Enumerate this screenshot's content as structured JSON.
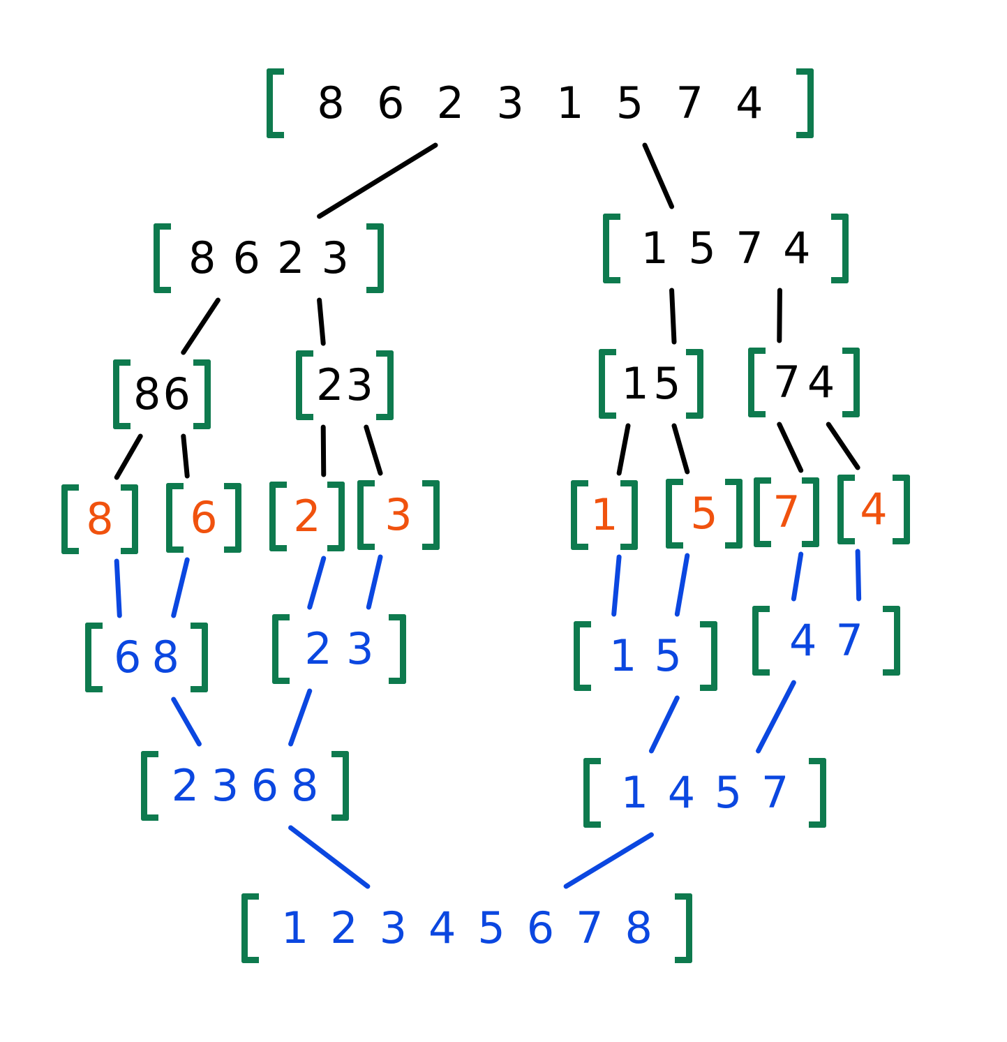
{
  "colors": {
    "bracket": "#0e7a4e",
    "split": "#000000",
    "leaf": "#f0520e",
    "merge": "#0b47e0"
  },
  "nodes": [
    {
      "id": "root",
      "stage": "split",
      "digits": [
        "8",
        "6",
        "2",
        "3",
        "1",
        "5",
        "7",
        "4"
      ]
    },
    {
      "id": "split-l",
      "stage": "split",
      "digits": [
        "8",
        "6",
        "2",
        "3"
      ]
    },
    {
      "id": "split-r",
      "stage": "split",
      "digits": [
        "1",
        "5",
        "7",
        "4"
      ]
    },
    {
      "id": "split-ll",
      "stage": "split",
      "digits": [
        "8",
        "6"
      ]
    },
    {
      "id": "split-lr",
      "stage": "split",
      "digits": [
        "2",
        "3"
      ]
    },
    {
      "id": "split-rl",
      "stage": "split",
      "digits": [
        "1",
        "5"
      ]
    },
    {
      "id": "split-rr",
      "stage": "split",
      "digits": [
        "7",
        "4"
      ]
    },
    {
      "id": "leaf-8",
      "stage": "leaf",
      "digits": [
        "8"
      ]
    },
    {
      "id": "leaf-6",
      "stage": "leaf",
      "digits": [
        "6"
      ]
    },
    {
      "id": "leaf-2",
      "stage": "leaf",
      "digits": [
        "2"
      ]
    },
    {
      "id": "leaf-3",
      "stage": "leaf",
      "digits": [
        "3"
      ]
    },
    {
      "id": "leaf-1",
      "stage": "leaf",
      "digits": [
        "1"
      ]
    },
    {
      "id": "leaf-5",
      "stage": "leaf",
      "digits": [
        "5"
      ]
    },
    {
      "id": "leaf-7",
      "stage": "leaf",
      "digits": [
        "7"
      ]
    },
    {
      "id": "leaf-4",
      "stage": "leaf",
      "digits": [
        "4"
      ]
    },
    {
      "id": "merge-68",
      "stage": "merge",
      "digits": [
        "6",
        "8"
      ]
    },
    {
      "id": "merge-23",
      "stage": "merge",
      "digits": [
        "2",
        "3"
      ]
    },
    {
      "id": "merge-15",
      "stage": "merge",
      "digits": [
        "1",
        "5"
      ]
    },
    {
      "id": "merge-47",
      "stage": "merge",
      "digits": [
        "4",
        "7"
      ]
    },
    {
      "id": "merge-2368",
      "stage": "merge",
      "digits": [
        "2",
        "3",
        "6",
        "8"
      ]
    },
    {
      "id": "merge-1457",
      "stage": "merge",
      "digits": [
        "1",
        "4",
        "5",
        "7"
      ]
    },
    {
      "id": "result",
      "stage": "merge",
      "digits": [
        "1",
        "2",
        "3",
        "4",
        "5",
        "6",
        "7",
        "8"
      ]
    }
  ],
  "edges": [
    {
      "from": "root",
      "to": "split-l",
      "stage": "split"
    },
    {
      "from": "root",
      "to": "split-r",
      "stage": "split"
    },
    {
      "from": "split-l",
      "to": "split-ll",
      "stage": "split"
    },
    {
      "from": "split-l",
      "to": "split-lr",
      "stage": "split"
    },
    {
      "from": "split-r",
      "to": "split-rl",
      "stage": "split"
    },
    {
      "from": "split-r",
      "to": "split-rr",
      "stage": "split"
    },
    {
      "from": "split-ll",
      "to": "leaf-8",
      "stage": "split"
    },
    {
      "from": "split-ll",
      "to": "leaf-6",
      "stage": "split"
    },
    {
      "from": "split-lr",
      "to": "leaf-2",
      "stage": "split"
    },
    {
      "from": "split-lr",
      "to": "leaf-3",
      "stage": "split"
    },
    {
      "from": "split-rl",
      "to": "leaf-1",
      "stage": "split"
    },
    {
      "from": "split-rl",
      "to": "leaf-5",
      "stage": "split"
    },
    {
      "from": "split-rr",
      "to": "leaf-7",
      "stage": "split"
    },
    {
      "from": "split-rr",
      "to": "leaf-4",
      "stage": "split"
    },
    {
      "from": "leaf-8",
      "to": "merge-68",
      "stage": "merge"
    },
    {
      "from": "leaf-6",
      "to": "merge-68",
      "stage": "merge"
    },
    {
      "from": "leaf-2",
      "to": "merge-23",
      "stage": "merge"
    },
    {
      "from": "leaf-3",
      "to": "merge-23",
      "stage": "merge"
    },
    {
      "from": "leaf-1",
      "to": "merge-15",
      "stage": "merge"
    },
    {
      "from": "leaf-5",
      "to": "merge-15",
      "stage": "merge"
    },
    {
      "from": "leaf-7",
      "to": "merge-47",
      "stage": "merge"
    },
    {
      "from": "leaf-4",
      "to": "merge-47",
      "stage": "merge"
    },
    {
      "from": "merge-68",
      "to": "merge-2368",
      "stage": "merge"
    },
    {
      "from": "merge-23",
      "to": "merge-2368",
      "stage": "merge"
    },
    {
      "from": "merge-15",
      "to": "merge-1457",
      "stage": "merge"
    },
    {
      "from": "merge-47",
      "to": "merge-1457",
      "stage": "merge"
    },
    {
      "from": "merge-2368",
      "to": "result",
      "stage": "merge"
    },
    {
      "from": "merge-1457",
      "to": "result",
      "stage": "merge"
    }
  ]
}
